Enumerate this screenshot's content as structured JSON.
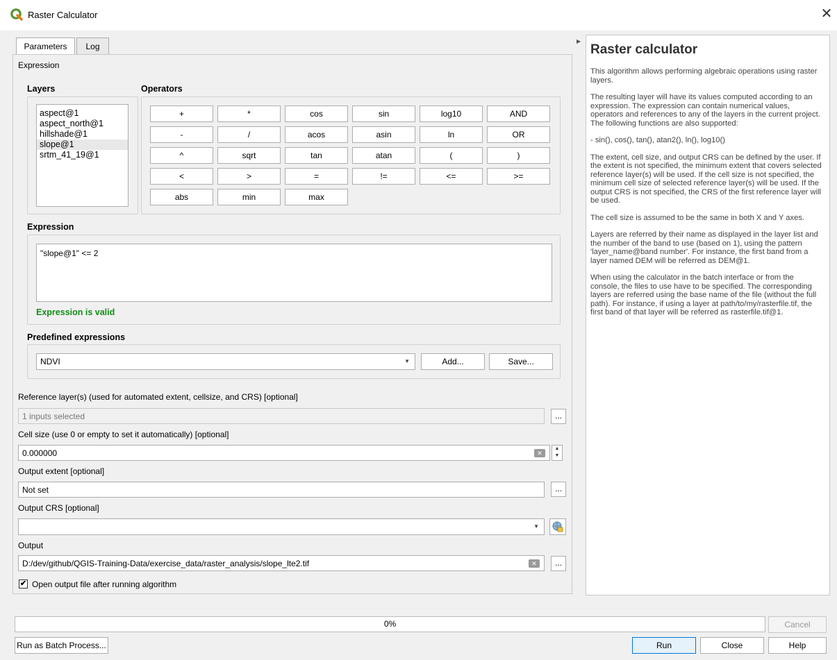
{
  "window": {
    "title": "Raster Calculator",
    "close_glyph": "✕",
    "app_icon": "qgis-logo-icon"
  },
  "tabs": [
    {
      "label": "Parameters",
      "active": true
    },
    {
      "label": "Log",
      "active": false
    }
  ],
  "expression_section": {
    "label": "Expression",
    "layers_label": "Layers",
    "operators_label": "Operators",
    "layers": [
      "aspect@1",
      "aspect_north@1",
      "hillshade@1",
      "slope@1",
      "srtm_41_19@1"
    ],
    "selected_layer": "slope@1",
    "operators": [
      [
        "+",
        "*",
        "cos",
        "sin",
        "log10",
        "AND"
      ],
      [
        "-",
        "/",
        "acos",
        "asin",
        "ln",
        "OR"
      ],
      [
        "^",
        "sqrt",
        "tan",
        "atan",
        "(",
        ")"
      ],
      [
        "<",
        ">",
        "=",
        "!=",
        "<=",
        ">="
      ],
      [
        "abs",
        "min",
        "max"
      ]
    ],
    "expression_label": "Expression",
    "expression_value": "\"slope@1\" <= 2",
    "validity": "Expression is valid",
    "predefined_label": "Predefined expressions",
    "predefined_value": "NDVI",
    "add_button": "Add...",
    "save_button": "Save..."
  },
  "reference_layers": {
    "label": "Reference layer(s) (used for automated extent, cellsize, and CRS) [optional]",
    "value": "1 inputs selected",
    "button": "..."
  },
  "cell_size": {
    "label": "Cell size (use 0 or empty to set it automatically) [optional]",
    "value": "0.000000"
  },
  "output_extent": {
    "label": "Output extent [optional]",
    "value": "Not set",
    "button": "..."
  },
  "output_crs": {
    "label": "Output CRS [optional]",
    "value": ""
  },
  "output": {
    "label": "Output",
    "value": "D:/dev/github/QGIS-Training-Data/exercise_data/raster_analysis/slope_lte2.tif",
    "button": "..."
  },
  "open_output": {
    "label": "Open output file after running algorithm",
    "checked": true,
    "check_glyph": "✔"
  },
  "help": {
    "title": "Raster calculator",
    "paragraphs": [
      "This algorithm allows performing algebraic operations using raster layers.",
      "The resulting layer will have its values computed according to an expression. The expression can contain numerical values, operators and references to any of the layers in the current project. The following functions are also supported:",
      "- sin(), cos(), tan(), atan2(), ln(), log10()",
      "The extent, cell size, and output CRS can be defined by the user. If the extent is not specified, the minimum extent that covers selected reference layer(s) will be used. If the cell size is not specified, the minimum cell size of selected reference layer(s) will be used. If the output CRS is not specified, the CRS of the first reference layer will be used.",
      "The cell size is assumed to be the same in both X and Y axes.",
      "Layers are referred by their name as displayed in the layer list and the number of the band to use (based on 1), using the pattern 'layer_name@band number'. For instance, the first band from a layer named DEM will be referred as DEM@1.",
      "When using the calculator in the batch interface or from the console, the files to use have to be specified. The corresponding layers are referred using the base name of the file (without the full path). For instance, if using a layer at path/to/my/rasterfile.tif, the first band of that layer will be referred as rasterfile.tif@1."
    ]
  },
  "progress": {
    "text": "0%",
    "percent": 0
  },
  "buttons": {
    "cancel": "Cancel",
    "batch": "Run as Batch Process...",
    "run": "Run",
    "close": "Close",
    "help": "Help"
  },
  "colors": {
    "valid": "#138d18",
    "run_border": "#0078d7",
    "qgis_green": "#589632"
  }
}
